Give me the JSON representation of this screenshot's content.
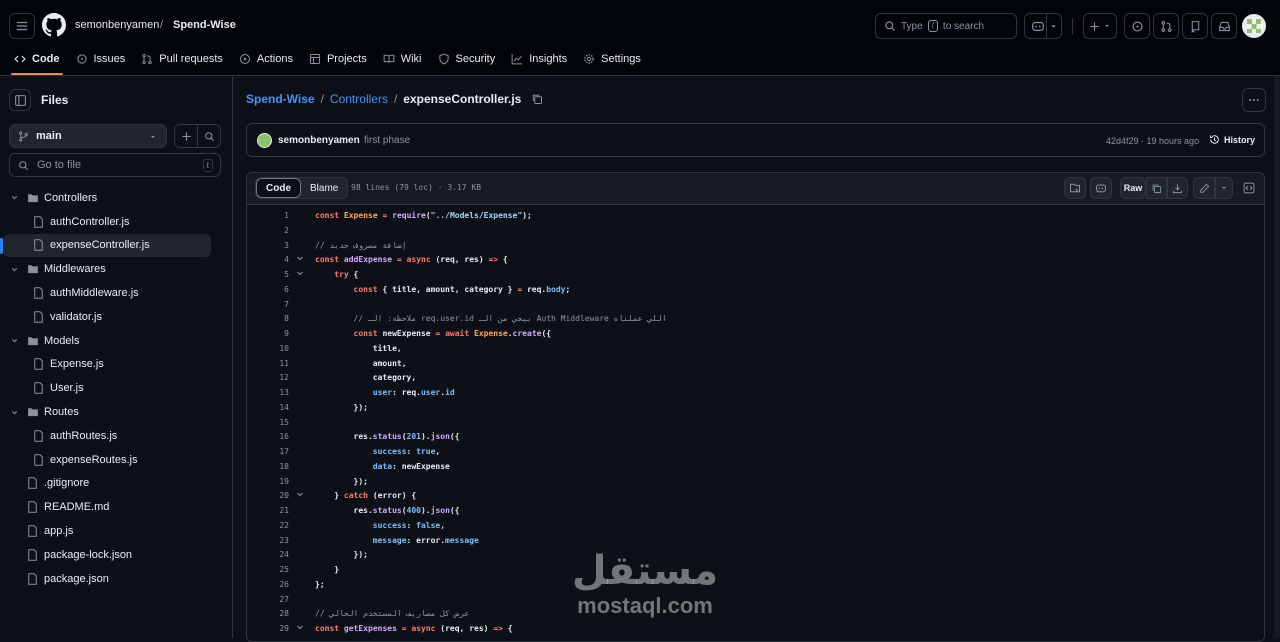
{
  "header": {
    "owner": "semonbenyamen",
    "separator": "/",
    "repo": "Spend-Wise",
    "search_placeholder_prefix": "Type",
    "search_key": "/",
    "search_placeholder_suffix": "to search"
  },
  "nav": {
    "tabs": [
      {
        "label": "Code",
        "icon": "code-icon",
        "active": true
      },
      {
        "label": "Issues",
        "icon": "issue-icon"
      },
      {
        "label": "Pull requests",
        "icon": "pull-request-icon"
      },
      {
        "label": "Actions",
        "icon": "play-icon"
      },
      {
        "label": "Projects",
        "icon": "table-icon"
      },
      {
        "label": "Wiki",
        "icon": "book-icon"
      },
      {
        "label": "Security",
        "icon": "shield-icon"
      },
      {
        "label": "Insights",
        "icon": "graph-icon"
      },
      {
        "label": "Settings",
        "icon": "gear-icon"
      }
    ]
  },
  "sidebar": {
    "title": "Files",
    "branch": "main",
    "goto_placeholder": "Go to file",
    "goto_key": "t",
    "tree": [
      {
        "label": "Controllers",
        "type": "folder",
        "depth": 0
      },
      {
        "label": "authController.js",
        "type": "file",
        "depth": 1
      },
      {
        "label": "expenseController.js",
        "type": "file",
        "depth": 1,
        "selected": true
      },
      {
        "label": "Middlewares",
        "type": "folder",
        "depth": 0
      },
      {
        "label": "authMiddleware.js",
        "type": "file",
        "depth": 1
      },
      {
        "label": "validator.js",
        "type": "file",
        "depth": 1
      },
      {
        "label": "Models",
        "type": "folder",
        "depth": 0
      },
      {
        "label": "Expense.js",
        "type": "file",
        "depth": 1
      },
      {
        "label": "User.js",
        "type": "file",
        "depth": 1
      },
      {
        "label": "Routes",
        "type": "folder",
        "depth": 0
      },
      {
        "label": "authRoutes.js",
        "type": "file",
        "depth": 1
      },
      {
        "label": "expenseRoutes.js",
        "type": "file",
        "depth": 1
      },
      {
        "label": ".gitignore",
        "type": "file",
        "depth": 0
      },
      {
        "label": "README.md",
        "type": "file",
        "depth": 0
      },
      {
        "label": "app.js",
        "type": "file",
        "depth": 0
      },
      {
        "label": "package-lock.json",
        "type": "file",
        "depth": 0
      },
      {
        "label": "package.json",
        "type": "file",
        "depth": 0
      }
    ]
  },
  "breadcrumb": {
    "repo": "Spend-Wise",
    "folder": "Controllers",
    "file": "expenseController.js",
    "sep": "/"
  },
  "commit": {
    "author": "semonbenyamen",
    "message": "first phase",
    "sha_time": "42d4f29 · 19 hours ago",
    "history": "History"
  },
  "file": {
    "code_tab": "Code",
    "blame_tab": "Blame",
    "meta": "98 lines (79 loc) · 3.17 KB",
    "raw": "Raw"
  },
  "code_lines": [
    {
      "n": "1",
      "html": "<span class=\"k\">const</span> <span class=\"v\">Expense</span> <span class=\"k\">=</span> <span class=\"f\">require</span>(<span class=\"s\">\"../Models/Expense\"</span>);"
    },
    {
      "n": "2",
      "html": ""
    },
    {
      "n": "3",
      "html": "<span class=\"c\">// إضافة مصروف جديد</span>"
    },
    {
      "n": "4",
      "fold": true,
      "html": "<span class=\"k\">const</span> <span class=\"f\">addExpense</span> <span class=\"k\">=</span> <span class=\"k\">async</span> (req, res) <span class=\"k\">=&gt;</span> {"
    },
    {
      "n": "5",
      "fold": true,
      "html": "    <span class=\"k\">try</span> {"
    },
    {
      "n": "6",
      "html": "        <span class=\"k\">const</span> { title, amount, category } <span class=\"k\">=</span> req.<span class=\"n\">body</span>;"
    },
    {
      "n": "7",
      "html": ""
    },
    {
      "n": "8",
      "html": "        <span class=\"c\">// ملاحظة: الـ req.user.id بيجي من الـ Auth Middleware اللي عملناه</span>"
    },
    {
      "n": "9",
      "html": "        <span class=\"k\">const</span> newExpense <span class=\"k\">=</span> <span class=\"k\">await</span> <span class=\"v\">Expense</span>.<span class=\"f\">create</span>({"
    },
    {
      "n": "10",
      "html": "            title,"
    },
    {
      "n": "11",
      "html": "            amount,"
    },
    {
      "n": "12",
      "html": "            category,"
    },
    {
      "n": "13",
      "html": "            <span class=\"n\">user</span>: req.<span class=\"n\">user</span>.<span class=\"n\">id</span>"
    },
    {
      "n": "14",
      "html": "        });"
    },
    {
      "n": "15",
      "html": ""
    },
    {
      "n": "16",
      "html": "        res.<span class=\"f\">status</span>(<span class=\"n\">201</span>).<span class=\"f\">json</span>({"
    },
    {
      "n": "17",
      "html": "            <span class=\"n\">success</span>: <span class=\"n\">true</span>,"
    },
    {
      "n": "18",
      "html": "            <span class=\"n\">data</span>: newExpense"
    },
    {
      "n": "19",
      "html": "        });"
    },
    {
      "n": "20",
      "fold": true,
      "html": "    } <span class=\"k\">catch</span> (error) {"
    },
    {
      "n": "21",
      "html": "        res.<span class=\"f\">status</span>(<span class=\"n\">400</span>).<span class=\"f\">json</span>({"
    },
    {
      "n": "22",
      "html": "            <span class=\"n\">success</span>: <span class=\"n\">false</span>,"
    },
    {
      "n": "23",
      "html": "            <span class=\"n\">message</span>: error.<span class=\"n\">message</span>"
    },
    {
      "n": "24",
      "html": "        });"
    },
    {
      "n": "25",
      "html": "    }"
    },
    {
      "n": "26",
      "html": "};"
    },
    {
      "n": "27",
      "html": ""
    },
    {
      "n": "28",
      "html": "<span class=\"c\">// عرض كل مصاريف المستخدم الحالي</span>"
    },
    {
      "n": "29",
      "fold": true,
      "html": "<span class=\"k\">const</span> <span class=\"f\">getExpenses</span> <span class=\"k\">=</span> <span class=\"k\">async</span> (req, res) <span class=\"k\">=&gt;</span> {"
    }
  ],
  "watermark": {
    "arabic": "مستقل",
    "latin": "mostaql.com"
  },
  "colors": {
    "bg": "#0d1117",
    "accent": "#f78166",
    "link": "#4493f8",
    "border": "#30363d"
  }
}
